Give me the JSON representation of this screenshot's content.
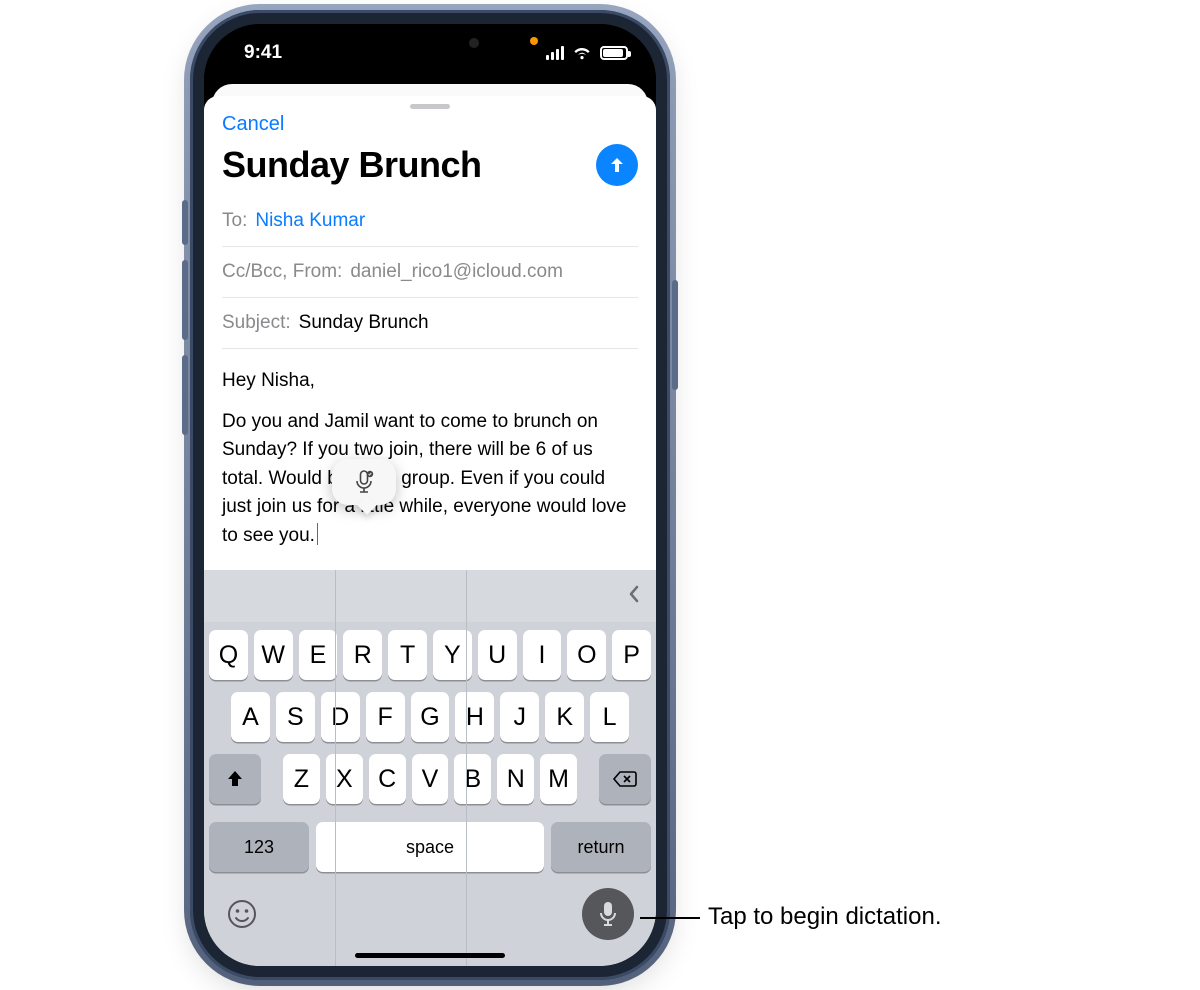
{
  "status": {
    "time": "9:41"
  },
  "sheet": {
    "cancel": "Cancel",
    "title": "Sunday Brunch"
  },
  "fields": {
    "to_label": "To:",
    "to_value": "Nisha Kumar",
    "ccfrom_label": "Cc/Bcc, From:",
    "ccfrom_value": "daniel_rico1@icloud.com",
    "subject_label": "Subject:",
    "subject_value": "Sunday Brunch"
  },
  "body": {
    "p1": "Hey Nisha,",
    "p2": "Do you and Jamil want to come to brunch on Sunday? If you two join, there will be 6 of us total. Would be a fun group. Even if you could just join us for a little while, everyone would love to see you."
  },
  "keyboard": {
    "row1": [
      "Q",
      "W",
      "E",
      "R",
      "T",
      "Y",
      "U",
      "I",
      "O",
      "P"
    ],
    "row2": [
      "A",
      "S",
      "D",
      "F",
      "G",
      "H",
      "J",
      "K",
      "L"
    ],
    "row3": [
      "Z",
      "X",
      "C",
      "V",
      "B",
      "N",
      "M"
    ],
    "nums": "123",
    "space": "space",
    "return": "return"
  },
  "callout": "Tap to begin dictation."
}
